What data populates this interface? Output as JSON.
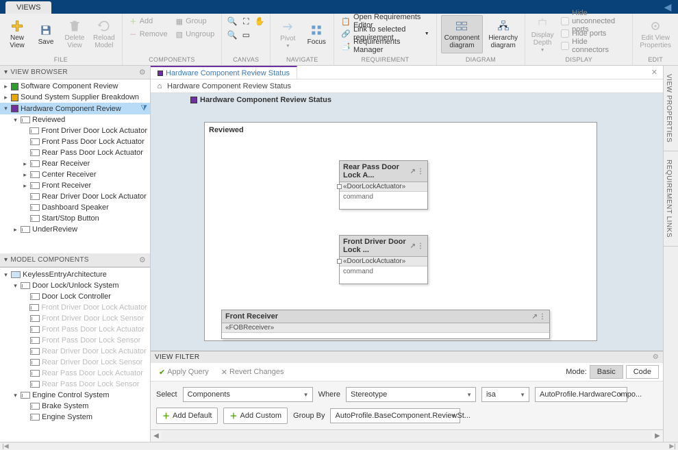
{
  "app": {
    "active_tab": "VIEWS"
  },
  "ribbon": {
    "file": {
      "label": "FILE",
      "new_view": "New\nView",
      "save": "Save",
      "delete_view": "Delete\nView",
      "reload_model": "Reload\nModel"
    },
    "components": {
      "label": "COMPONENTS",
      "add": "Add",
      "remove": "Remove",
      "group": "Group",
      "ungroup": "Ungroup"
    },
    "canvas": {
      "label": "CANVAS"
    },
    "navigate": {
      "label": "NAVIGATE",
      "pivot": "Pivot",
      "focus": "Focus"
    },
    "requirement": {
      "label": "REQUIREMENT",
      "open_editor": "Open Requirements Editor",
      "link_selected": "Link to selected requirement",
      "manager": "Requirements Manager"
    },
    "diagram": {
      "label": "DIAGRAM",
      "component_diagram": "Component\ndiagram",
      "hierarchy_diagram": "Hierarchy\ndiagram"
    },
    "display": {
      "label": "DISPLAY",
      "depth": "Display\nDepth",
      "hide_unconnected": "Hide unconnected ports",
      "hide_ports": "Hide ports",
      "hide_connectors": "Hide connectors"
    },
    "edit": {
      "label": "EDIT",
      "edit_view_props": "Edit View\nProperties"
    }
  },
  "view_browser": {
    "header": "VIEW BROWSER",
    "items": [
      {
        "label": "Software Component Review",
        "color": "#2e9e2e"
      },
      {
        "label": "Sound System Supplier Breakdown",
        "color": "#e8a400"
      },
      {
        "label": "Hardware Component Review",
        "color": "#7030a0",
        "selected": true,
        "has_filter": true
      }
    ],
    "hw_children": [
      {
        "label": "Reviewed",
        "expandable": true,
        "expanded": true,
        "children": [
          "Front Driver Door Lock Actuator",
          "Front Pass Door Lock Actuator",
          "Rear Pass Door Lock Actuator",
          "Rear Receiver",
          "Center Receiver",
          "Front Receiver",
          "Rear Driver Door Lock Actuator",
          "Dashboard Speaker",
          "Start/Stop Button"
        ]
      },
      {
        "label": "UnderReview",
        "expandable": true,
        "expanded": false
      }
    ]
  },
  "model_components": {
    "header": "MODEL COMPONENTS",
    "root": "KeylessEntryArchitecture",
    "door_system": {
      "label": "Door Lock/Unlock System",
      "children": [
        {
          "label": "Door Lock Controller",
          "dim": false
        },
        {
          "label": "Front Driver Door Lock Actuator",
          "dim": true
        },
        {
          "label": "Front Driver Door Lock Sensor",
          "dim": true
        },
        {
          "label": "Front Pass Door Lock Actuator",
          "dim": true
        },
        {
          "label": "Front Pass Door Lock Sensor",
          "dim": true
        },
        {
          "label": "Rear Driver Door Lock Actuator",
          "dim": true
        },
        {
          "label": "Rear Driver Door Lock Sensor",
          "dim": true
        },
        {
          "label": "Rear Pass Door Lock Actuator",
          "dim": true
        },
        {
          "label": "Rear Pass Door Lock Sensor",
          "dim": true
        }
      ]
    },
    "engine_system": {
      "label": "Engine Control System",
      "children": [
        {
          "label": "Brake System",
          "dim": false
        },
        {
          "label": "Engine System",
          "dim": false
        }
      ]
    }
  },
  "document": {
    "tab_title": "Hardware Component Review Status",
    "breadcrumb": "Hardware Component Review Status",
    "canvas_title": "Hardware Component Review Status",
    "group_title": "Reviewed",
    "comp1": {
      "title": "Rear Pass Door Lock A...",
      "stereo": "«DoorLockActuator»",
      "port": "command"
    },
    "comp2": {
      "title": "Front Driver Door Lock ...",
      "stereo": "«DoorLockActuator»",
      "port": "command"
    },
    "comp3": {
      "title": "Front Receiver",
      "stereo": "«FOBReceiver»"
    }
  },
  "view_filter": {
    "header": "VIEW FILTER",
    "apply_query": "Apply Query",
    "revert_changes": "Revert Changes",
    "mode_label": "Mode:",
    "mode_basic": "Basic",
    "mode_code": "Code",
    "select_label": "Select",
    "select_value": "Components",
    "where_label": "Where",
    "where_value": "Stereotype",
    "op_value": "isa",
    "target_value": "AutoProfile.HardwareCompo...",
    "add_default": "Add Default",
    "add_custom": "Add Custom",
    "group_by_label": "Group By",
    "group_by_value": "AutoProfile.BaseComponent.ReviewSt..."
  },
  "right_tabs": {
    "properties": "VIEW PROPERTIES",
    "req_links": "REQUIREMENT LINKS"
  }
}
